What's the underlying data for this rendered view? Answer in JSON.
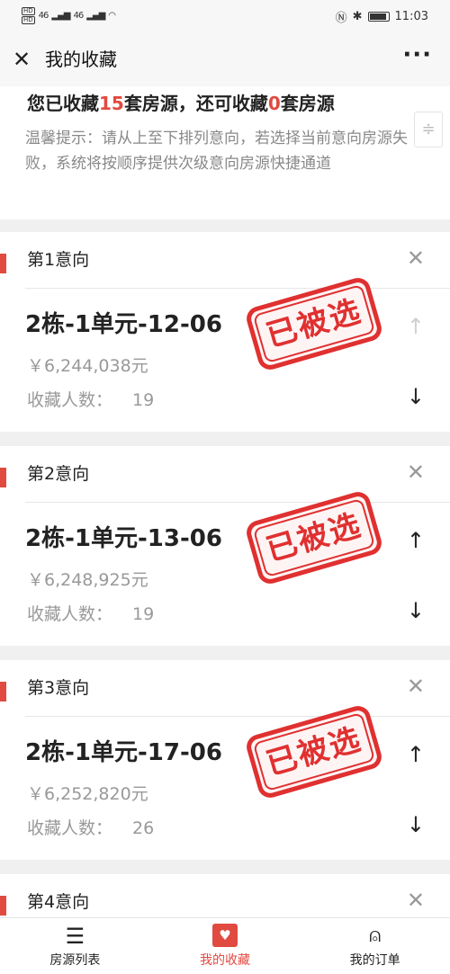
{
  "status_bar": {
    "hd1": "HD",
    "hd2": "HD",
    "net1": "46",
    "net2": "46",
    "time": "11:03"
  },
  "header": {
    "title": "我的收藏"
  },
  "summary": {
    "prefix": "您已收藏",
    "collected": "15",
    "middle": "套房源，还可收藏",
    "remaining": "0",
    "suffix": "套房源",
    "tip": "温馨提示：请从上至下排列意向，若选择当前意向房源失败，系统将按顺序提供次级意向房源快捷通道"
  },
  "stamp_text": "已被选",
  "fav_label": "收藏人数：",
  "cards": [
    {
      "label": "第1意向",
      "name": "2栋-1单元-12-06",
      "price": "￥6,244,038元",
      "count": "19"
    },
    {
      "label": "第2意向",
      "name": "2栋-1单元-13-06",
      "price": "￥6,248,925元",
      "count": "19"
    },
    {
      "label": "第3意向",
      "name": "2栋-1单元-17-06",
      "price": "￥6,252,820元",
      "count": "26"
    },
    {
      "label": "第4意向"
    }
  ],
  "tabs": [
    {
      "label": "房源列表",
      "icon": "list-icon"
    },
    {
      "label": "我的收藏",
      "icon": "favorite-icon",
      "active": true
    },
    {
      "label": "我的订单",
      "icon": "person-icon"
    }
  ],
  "colors": {
    "accent": "#e14a40",
    "stamp": "#e03030"
  }
}
